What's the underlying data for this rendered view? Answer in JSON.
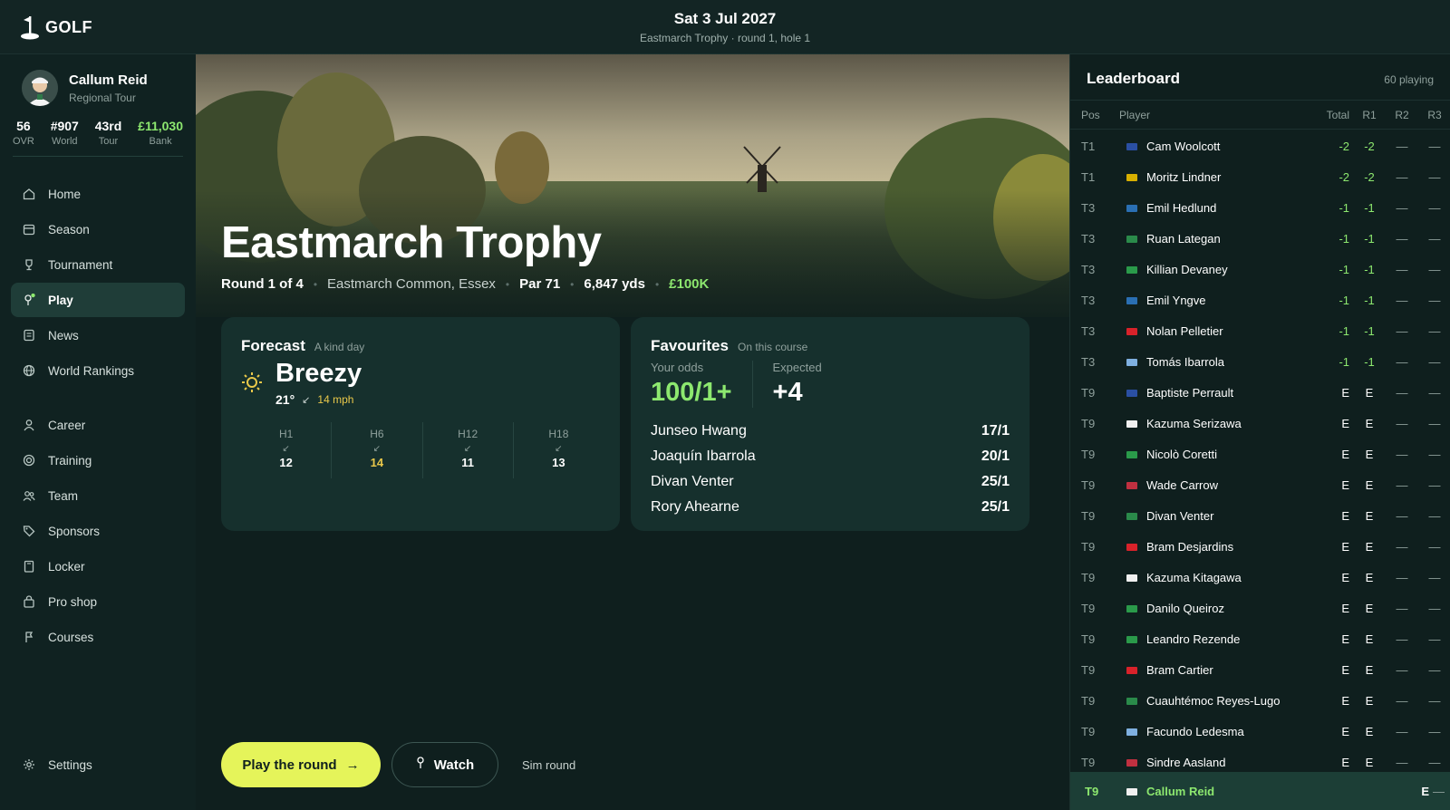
{
  "app": {
    "name": "GOLF"
  },
  "header": {
    "date": "Sat 3 Jul 2027",
    "subtitle": "Eastmarch Trophy · round 1, hole 1"
  },
  "profile": {
    "name": "Callum Reid",
    "tour": "Regional Tour",
    "stats": [
      {
        "value": "56",
        "label": "OVR"
      },
      {
        "value": "#907",
        "label": "World"
      },
      {
        "value": "43rd",
        "label": "Tour"
      },
      {
        "value": "£11,030",
        "label": "Bank"
      }
    ]
  },
  "nav": [
    {
      "label": "Home",
      "icon": "home-icon"
    },
    {
      "label": "Season",
      "icon": "calendar-icon"
    },
    {
      "label": "Tournament",
      "icon": "trophy-icon"
    },
    {
      "label": "Play",
      "icon": "tee-icon",
      "active": true
    },
    {
      "label": "News",
      "icon": "news-icon"
    },
    {
      "label": "World Rankings",
      "icon": "globe-icon"
    },
    {
      "label": "Career",
      "icon": "person-icon"
    },
    {
      "label": "Training",
      "icon": "target-icon"
    },
    {
      "label": "Team",
      "icon": "team-icon"
    },
    {
      "label": "Sponsors",
      "icon": "tag-icon"
    },
    {
      "label": "Locker",
      "icon": "locker-icon"
    },
    {
      "label": "Pro shop",
      "icon": "bag-icon"
    },
    {
      "label": "Courses",
      "icon": "flag-icon"
    },
    {
      "label": "Settings",
      "icon": "gear-icon"
    }
  ],
  "tournament": {
    "title": "Eastmarch Trophy",
    "round": "Round 1 of 4",
    "venue": "Eastmarch Common, Essex",
    "par": "Par 71",
    "yards": "6,847 yds",
    "prize": "£100K"
  },
  "forecast": {
    "title": "Forecast",
    "subtitle": "A kind day",
    "condition": "Breezy",
    "temp": "21°",
    "wind": "14 mph",
    "icon": "sun-icon",
    "holes": [
      {
        "label": "H1",
        "value": "12"
      },
      {
        "label": "H6",
        "value": "14"
      },
      {
        "label": "H12",
        "value": "11"
      },
      {
        "label": "H18",
        "value": "13"
      }
    ]
  },
  "favourites": {
    "title": "Favourites",
    "subtitle": "On this course",
    "odds_label": "Your odds",
    "odds_value": "100/1+",
    "expected_label": "Expected",
    "expected_value": "+4",
    "list": [
      {
        "name": "Junseo Hwang",
        "odds": "17/1"
      },
      {
        "name": "Joaquín Ibarrola",
        "odds": "20/1"
      },
      {
        "name": "Divan Venter",
        "odds": "25/1"
      },
      {
        "name": "Rory Ahearne",
        "odds": "25/1"
      }
    ]
  },
  "actions": {
    "play": "Play the round",
    "watch": "Watch",
    "sim": "Sim round"
  },
  "leaderboard": {
    "title": "Leaderboard",
    "playing": "60 playing",
    "columns": {
      "pos": "Pos",
      "player": "Player",
      "total": "Total",
      "r1": "R1",
      "r2": "R2",
      "r3": "R3"
    },
    "rows": [
      {
        "pos": "T1",
        "name": "Cam Woolcott",
        "flag": "#2a4fa3",
        "total": "-2",
        "r1": "-2",
        "r2": "—",
        "r3": "—"
      },
      {
        "pos": "T1",
        "name": "Moritz Lindner",
        "flag": "#d8b000",
        "total": "-2",
        "r1": "-2",
        "r2": "—",
        "r3": "—"
      },
      {
        "pos": "T3",
        "name": "Emil Hedlund",
        "flag": "#2a6fb3",
        "total": "-1",
        "r1": "-1",
        "r2": "—",
        "r3": "—"
      },
      {
        "pos": "T3",
        "name": "Ruan Lategan",
        "flag": "#2a8a4a",
        "total": "-1",
        "r1": "-1",
        "r2": "—",
        "r3": "—"
      },
      {
        "pos": "T3",
        "name": "Killian Devaney",
        "flag": "#2a9a4a",
        "total": "-1",
        "r1": "-1",
        "r2": "—",
        "r3": "—"
      },
      {
        "pos": "T3",
        "name": "Emil Yngve",
        "flag": "#2a6fb3",
        "total": "-1",
        "r1": "-1",
        "r2": "—",
        "r3": "—"
      },
      {
        "pos": "T3",
        "name": "Nolan Pelletier",
        "flag": "#d8222a",
        "total": "-1",
        "r1": "-1",
        "r2": "—",
        "r3": "—"
      },
      {
        "pos": "T3",
        "name": "Tomás Ibarrola",
        "flag": "#7fb0e0",
        "total": "-1",
        "r1": "-1",
        "r2": "—",
        "r3": "—"
      },
      {
        "pos": "T9",
        "name": "Baptiste Perrault",
        "flag": "#2a4fa3",
        "total": "E",
        "r1": "E",
        "r2": "—",
        "r3": "—"
      },
      {
        "pos": "T9",
        "name": "Kazuma Serizawa",
        "flag": "#f0f0f0",
        "total": "E",
        "r1": "E",
        "r2": "—",
        "r3": "—"
      },
      {
        "pos": "T9",
        "name": "Nicolò Coretti",
        "flag": "#2a9a4a",
        "total": "E",
        "r1": "E",
        "r2": "—",
        "r3": "—"
      },
      {
        "pos": "T9",
        "name": "Wade Carrow",
        "flag": "#c03040",
        "total": "E",
        "r1": "E",
        "r2": "—",
        "r3": "—"
      },
      {
        "pos": "T9",
        "name": "Divan Venter",
        "flag": "#2a8a4a",
        "total": "E",
        "r1": "E",
        "r2": "—",
        "r3": "—"
      },
      {
        "pos": "T9",
        "name": "Bram Desjardins",
        "flag": "#d8222a",
        "total": "E",
        "r1": "E",
        "r2": "—",
        "r3": "—"
      },
      {
        "pos": "T9",
        "name": "Kazuma Kitagawa",
        "flag": "#f0f0f0",
        "total": "E",
        "r1": "E",
        "r2": "—",
        "r3": "—"
      },
      {
        "pos": "T9",
        "name": "Danilo Queiroz",
        "flag": "#2a9a4a",
        "total": "E",
        "r1": "E",
        "r2": "—",
        "r3": "—"
      },
      {
        "pos": "T9",
        "name": "Leandro Rezende",
        "flag": "#2a9a4a",
        "total": "E",
        "r1": "E",
        "r2": "—",
        "r3": "—"
      },
      {
        "pos": "T9",
        "name": "Bram Cartier",
        "flag": "#d8222a",
        "total": "E",
        "r1": "E",
        "r2": "—",
        "r3": "—"
      },
      {
        "pos": "T9",
        "name": "Cuauhtémoc Reyes-Lugo",
        "flag": "#2a8a4a",
        "total": "E",
        "r1": "E",
        "r2": "—",
        "r3": "—"
      },
      {
        "pos": "T9",
        "name": "Facundo Ledesma",
        "flag": "#7fb0e0",
        "total": "E",
        "r1": "E",
        "r2": "—",
        "r3": "—"
      },
      {
        "pos": "T9",
        "name": "Sindre Aasland",
        "flag": "#c03040",
        "total": "E",
        "r1": "E",
        "r2": "—",
        "r3": "—"
      }
    ],
    "me": {
      "pos": "T9",
      "name": "Callum Reid",
      "flag": "#f0f0f0",
      "total": "E",
      "r1": "—"
    }
  },
  "colors": {
    "accent": "#e5f45a",
    "positive": "#8de86f",
    "wind": "#e9c84a",
    "panel": "#16302d"
  }
}
